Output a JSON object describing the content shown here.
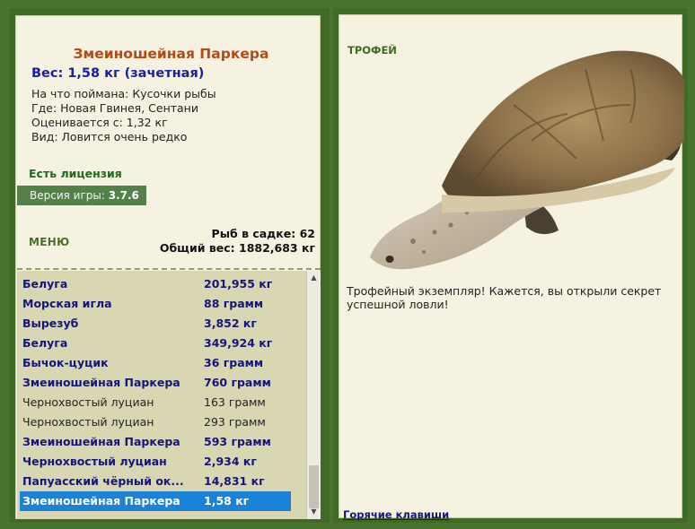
{
  "fish": {
    "title": "Змеиношейная Паркера",
    "weight": "Вес: 1,58 кг (зачетная)",
    "bait": "На что поймана: Кусочки рыбы",
    "location": "Где: Новая Гвинея, Сентани",
    "valued": "Оценивается с: 1,32 кг",
    "species": "Вид: Ловится очень редко"
  },
  "license": "Есть лицензия",
  "version": {
    "label": "Версия игры:",
    "value": "3.7.6"
  },
  "menu_label": "МЕНЮ",
  "cage": {
    "count": "Рыб в садке: 62",
    "total": "Общий вес: 1882,683 кг"
  },
  "catch_list": [
    {
      "name": "Белуга",
      "weight": "201,955 кг",
      "style": "bold"
    },
    {
      "name": "Морская игла",
      "weight": "88 грамм",
      "style": "bold"
    },
    {
      "name": "Вырезуб",
      "weight": "3,852 кг",
      "style": "bold"
    },
    {
      "name": "Белуга",
      "weight": "349,924 кг",
      "style": "bold"
    },
    {
      "name": "Бычок-цуцик",
      "weight": "36 грамм",
      "style": "bold"
    },
    {
      "name": "Змеиношейная Паркера",
      "weight": "760 грамм",
      "style": "bold"
    },
    {
      "name": "Чернохвостый луциан",
      "weight": "163 грамм",
      "style": "normal"
    },
    {
      "name": "Чернохвостый луциан",
      "weight": "293 грамм",
      "style": "normal"
    },
    {
      "name": "Змеиношейная Паркера",
      "weight": "593 грамм",
      "style": "bold"
    },
    {
      "name": "Чернохвостый луциан",
      "weight": "2,934 кг",
      "style": "bold"
    },
    {
      "name": "Папуасский чёрный ок...",
      "weight": "14,831 кг",
      "style": "bold"
    },
    {
      "name": "Змеиношейная Паркера",
      "weight": "1,58 кг",
      "style": "sel"
    }
  ],
  "trophy": {
    "label": "ТРОФЕЙ",
    "text": "Трофейный экземпляр! Кажется, вы открыли секрет успешной ловли!"
  },
  "hotkeys": "Горячие клавиши",
  "icons": {
    "scroll_up": "triangle-up-icon",
    "scroll_down": "triangle-down-icon"
  },
  "colors": {
    "title": "#b54a14",
    "link": "#15157a",
    "selection": "#1a83d8",
    "frame": "#3f6b27"
  }
}
